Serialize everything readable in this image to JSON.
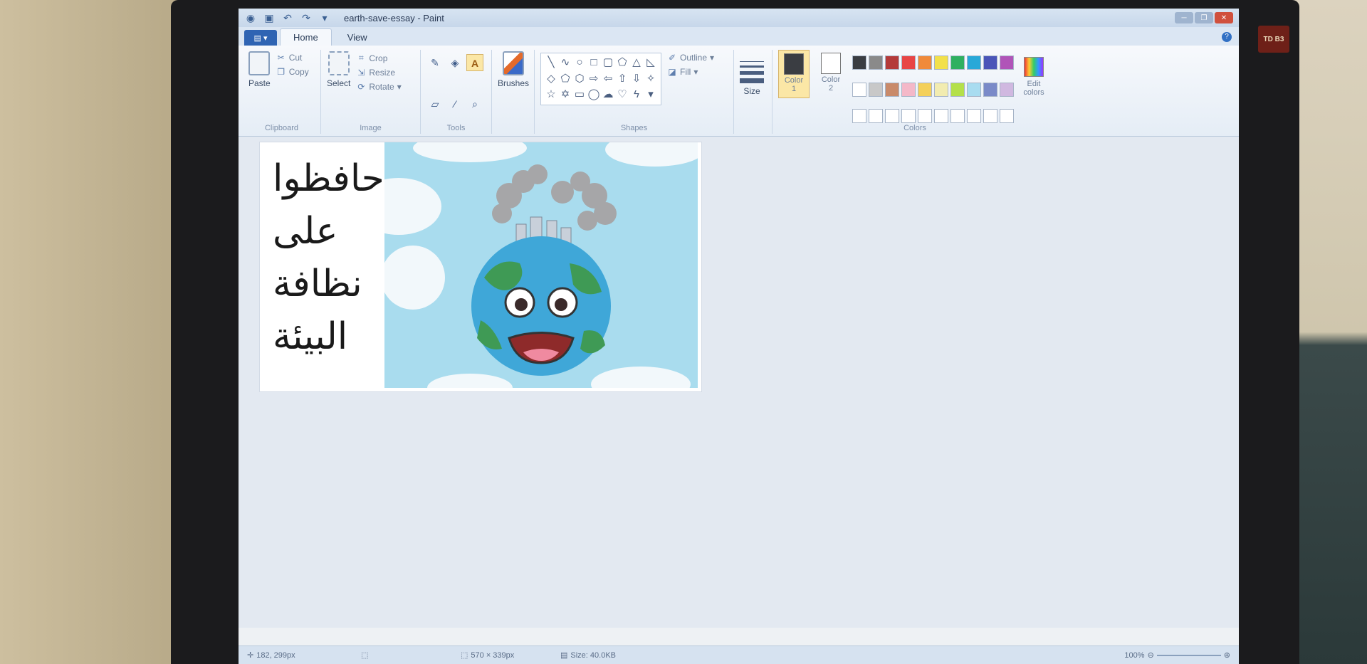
{
  "window": {
    "title": "earth-save-essay - Paint"
  },
  "tabs": [
    {
      "label": "Home"
    },
    {
      "label": "View"
    }
  ],
  "ribbon": {
    "clipboard": {
      "label": "Clipboard",
      "paste": "Paste",
      "cut": "Cut",
      "copy": "Copy"
    },
    "image": {
      "label": "Image",
      "select": "Select",
      "crop": "Crop",
      "resize": "Resize",
      "rotate": "Rotate"
    },
    "tools": {
      "label": "Tools"
    },
    "brushes": {
      "label": "Brushes"
    },
    "shapes": {
      "label": "Shapes",
      "outline": "Outline",
      "fill": "Fill"
    },
    "size": {
      "label": "Size"
    },
    "colors": {
      "label": "Colors",
      "color1": "Color",
      "color1_num": "1",
      "color2": "Color",
      "color2_num": "2",
      "edit_colors": "Edit colors",
      "color1_value": "#3a3d42",
      "color2_value": "#ffffff",
      "palette": [
        "#3a3d42",
        "#8a8a8a",
        "#b43a3a",
        "#e84545",
        "#f08a3a",
        "#f2e04a",
        "#2fb060",
        "#28a8d8",
        "#4a55b8",
        "#b054b8",
        "#ffffff",
        "#c8c8c8",
        "#c98a6a",
        "#f4b8c8",
        "#f4d05a",
        "#f2ecb0",
        "#b4e04a",
        "#a8dcf0",
        "#7a8ac8",
        "#d0b8e0",
        "#ffffff",
        "#ffffff",
        "#ffffff",
        "#ffffff",
        "#ffffff",
        "#ffffff",
        "#ffffff",
        "#ffffff",
        "#ffffff",
        "#ffffff"
      ]
    }
  },
  "canvas": {
    "text_lines": [
      "حافظوا",
      "على",
      "نظافة",
      "البيئة"
    ]
  },
  "status": {
    "cursor_pos": "182, 299px",
    "selection_size": "570 × 339px",
    "file_size": "Size: 40.0KB",
    "zoom": "100%"
  },
  "brand": {
    "monitor_badge": "TD B3"
  }
}
